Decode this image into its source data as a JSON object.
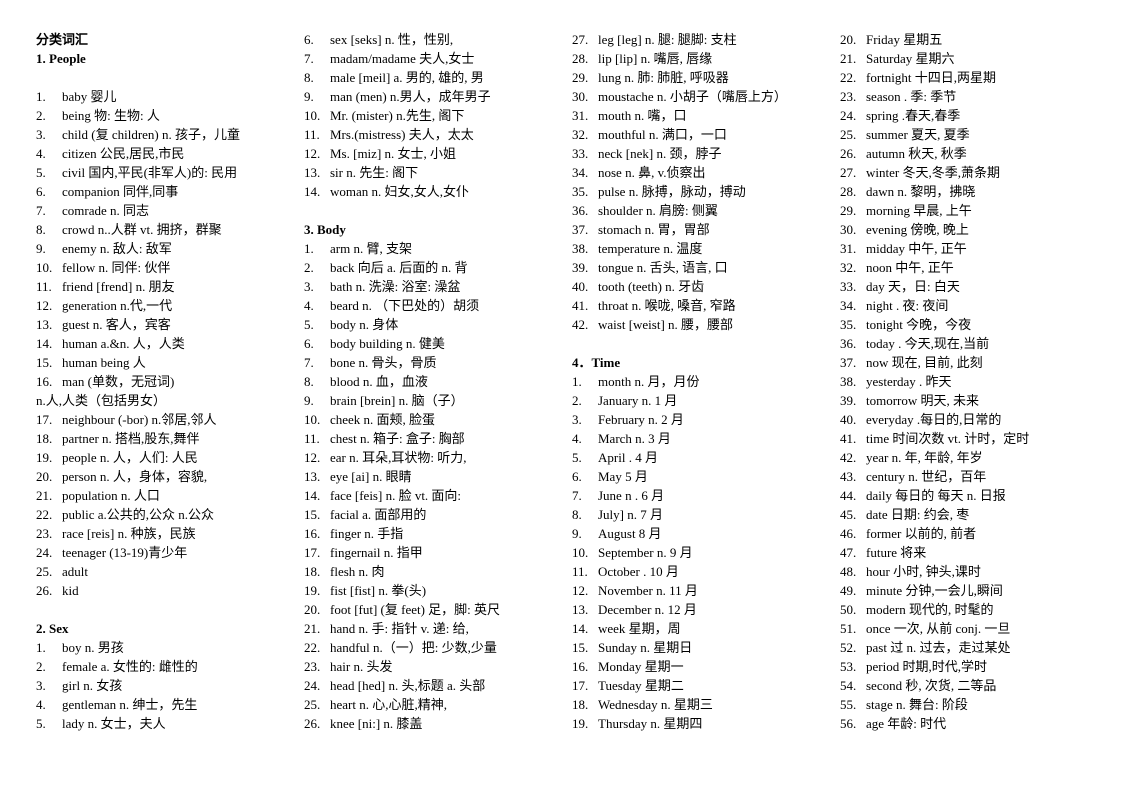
{
  "document": {
    "title": "分类词汇"
  },
  "columns": [
    {
      "id": "column-1",
      "blocks": [
        {
          "type": "title",
          "text": "分类词汇"
        },
        {
          "type": "heading",
          "text": "1. People"
        },
        {
          "type": "blank"
        },
        {
          "type": "list",
          "start": 1,
          "items": [
            "baby  婴儿",
            "being 物:  生物: 人",
            "child (复 children) n. 孩子，儿童",
            "citizen  公民,居民,市民",
            "civil 国内,平民(非军人)的: 民用",
            "companion 同伴,同事",
            "comrade  n. 同志",
            "crowd n..人群 vt. 拥挤，群聚",
            "enemy  n. 敌人: 敌军",
            "fellow  n. 同伴: 伙伴",
            "friend [frend] n. 朋友",
            "generation  n.代,一代",
            "guest  n. 客人，宾客",
            "human  a.&n. 人，人类",
            "human being 人",
            "man  (单数，无冠词)"
          ]
        },
        {
          "type": "cont",
          "text": "n.人,人类（包括男女）"
        },
        {
          "type": "list",
          "start": 17,
          "items": [
            "neighbour (-bor) n.邻居,邻人",
            "partner  n. 搭档,股东,舞伴",
            "people  n. 人，人们: 人民",
            "person n. 人，身体，容貌,",
            "population  n. 人口",
            "public a.公共的,公众 n.公众",
            "race [reis] n. 种族，民族",
            "teenager  (13-19)青少年",
            "adult",
            "kid"
          ]
        },
        {
          "type": "blank"
        },
        {
          "type": "heading",
          "text": "2. Sex"
        },
        {
          "type": "list",
          "start": 1,
          "items": [
            "boy n. 男孩",
            "female  a. 女性的: 雌性的",
            "girl  n. 女孩",
            "gentleman n. 绅士，先生",
            "lady n. 女士，夫人"
          ]
        }
      ]
    },
    {
      "id": "column-2",
      "blocks": [
        {
          "type": "list",
          "start": 6,
          "items": [
            "sex [seks] n. 性，性别,",
            "madam/madame 夫人,女士",
            "male [meil] a. 男的, 雄的, 男",
            "man  (men) n.男人，成年男子",
            "Mr.  (mister) n.先生, 阁下",
            "Mrs.(mistress) 夫人，太太",
            "Ms. [miz] n. 女士, 小姐",
            "sir n. 先生: 阁下",
            "woman  n. 妇女,女人,女仆"
          ]
        },
        {
          "type": "blank"
        },
        {
          "type": "heading",
          "text": "3. Body"
        },
        {
          "type": "list",
          "start": 1,
          "items": [
            "arm  n. 臂, 支架",
            "back  向后 a. 后面的 n. 背",
            "bath  n. 洗澡: 浴室: 澡盆",
            "beard n. （下巴处的）胡须",
            "body  n. 身体",
            "body building n. 健美",
            "bone  n. 骨头，骨质",
            "blood  n. 血，血液",
            "brain [brein] n. 脑（子）",
            "cheek n. 面颊, 脸蛋",
            "chest n. 箱子: 盒子: 胸部",
            "ear  n. 耳朵,耳状物: 听力,",
            "eye [ai] n. 眼睛",
            "face [feis] n. 脸 vt. 面向:",
            "facial a. 面部用的",
            "finger  n. 手指",
            "fingernail  n. 指甲",
            "flesh  n. 肉",
            "fist [fist] n. 拳(头)",
            "foot [fut] (复 feet) 足，脚: 英尺",
            "hand n. 手: 指针 v. 递: 给,",
            "handful n.（一）把: 少数,少量",
            "hair  n. 头发",
            "head [hed] n. 头,标题 a. 头部",
            "heart  n. 心,心脏,精神,",
            "knee [ni:] n. 膝盖"
          ]
        }
      ]
    },
    {
      "id": "column-3",
      "blocks": [
        {
          "type": "list",
          "start": 27,
          "items": [
            "leg [leg] n. 腿: 腿脚: 支柱",
            "lip [lip] n. 嘴唇, 唇缘",
            "lung n. 肺: 肺脏, 呼吸器",
            "moustache n. 小胡子（嘴唇上方）",
            "mouth  n. 嘴，口",
            "mouthful  n. 满口，一口",
            "neck [nek] n. 颈，脖子",
            "nose n. 鼻, v.侦察出",
            "pulse  n. 脉搏，脉动，搏动",
            "shoulder  n. 肩膀: 侧翼",
            "stomach  n. 胃，胃部",
            "temperature  n. 温度",
            "tongue n. 舌头, 语言, 口",
            "tooth (teeth) n. 牙齿",
            "throat  n. 喉咙, 嗓音, 窄路",
            "waist [weist] n. 腰，腰部"
          ]
        },
        {
          "type": "blank"
        },
        {
          "type": "heading",
          "text": "4．Time"
        },
        {
          "type": "list",
          "start": 1,
          "items": [
            "month n. 月，月份",
            "January n. 1 月",
            "February  n. 2 月",
            "March n. 3 月",
            "April  . 4 月",
            "May    5 月",
            "June  n . 6 月",
            "July] n. 7 月",
            "August     8 月",
            "September n. 9 月",
            "October  . 10 月",
            "November  n. 11 月",
            "December n. 12 月",
            "week    星期，周",
            "Sunday  n. 星期日",
            "Monday    星期一",
            "Tuesday    星期二",
            "Wednesday n. 星期三",
            "Thursday n. 星期四"
          ]
        }
      ]
    },
    {
      "id": "column-4",
      "blocks": [
        {
          "type": "list",
          "start": 20,
          "items": [
            "Friday    星期五",
            "Saturday    星期六",
            "fortnight  十四日,两星期",
            "season  . 季: 季节",
            "spring  .春天,春季",
            "summer   夏天, 夏季",
            "autumn   秋天, 秋季",
            "winter  冬天,冬季,萧条期",
            "dawn n. 黎明，拂晓",
            "morning   早晨, 上午",
            "evening   傍晚, 晚上",
            "midday  中午, 正午",
            "noon   中午, 正午",
            "day    天，日: 白天",
            "night  . 夜: 夜间",
            "tonight  今晚，今夜",
            "today .  今天,现在,当前",
            "now    现在, 目前, 此刻",
            "yesterday . 昨天",
            "tomorrow 明天, 未来",
            "everyday .每日的,日常的",
            "time 时间次数 vt. 计时，定时",
            "year  n. 年, 年龄, 年岁",
            "century n. 世纪，百年",
            "daily  每日的 每天 n. 日报",
            "date      日期: 约会, 枣",
            "former 以前的, 前者",
            "future     将来",
            "hour 小时, 钟头,课时",
            "minute 分钟,一会儿,瞬间",
            "modern 现代的, 时髦的",
            "once 一次, 从前 conj. 一旦",
            "past  过 n. 过去，走过某处",
            "period 时期,时代,学时",
            "second 秒, 次货, 二等品",
            "stage  n. 舞台: 阶段",
            "age    年龄: 时代"
          ]
        }
      ]
    }
  ]
}
